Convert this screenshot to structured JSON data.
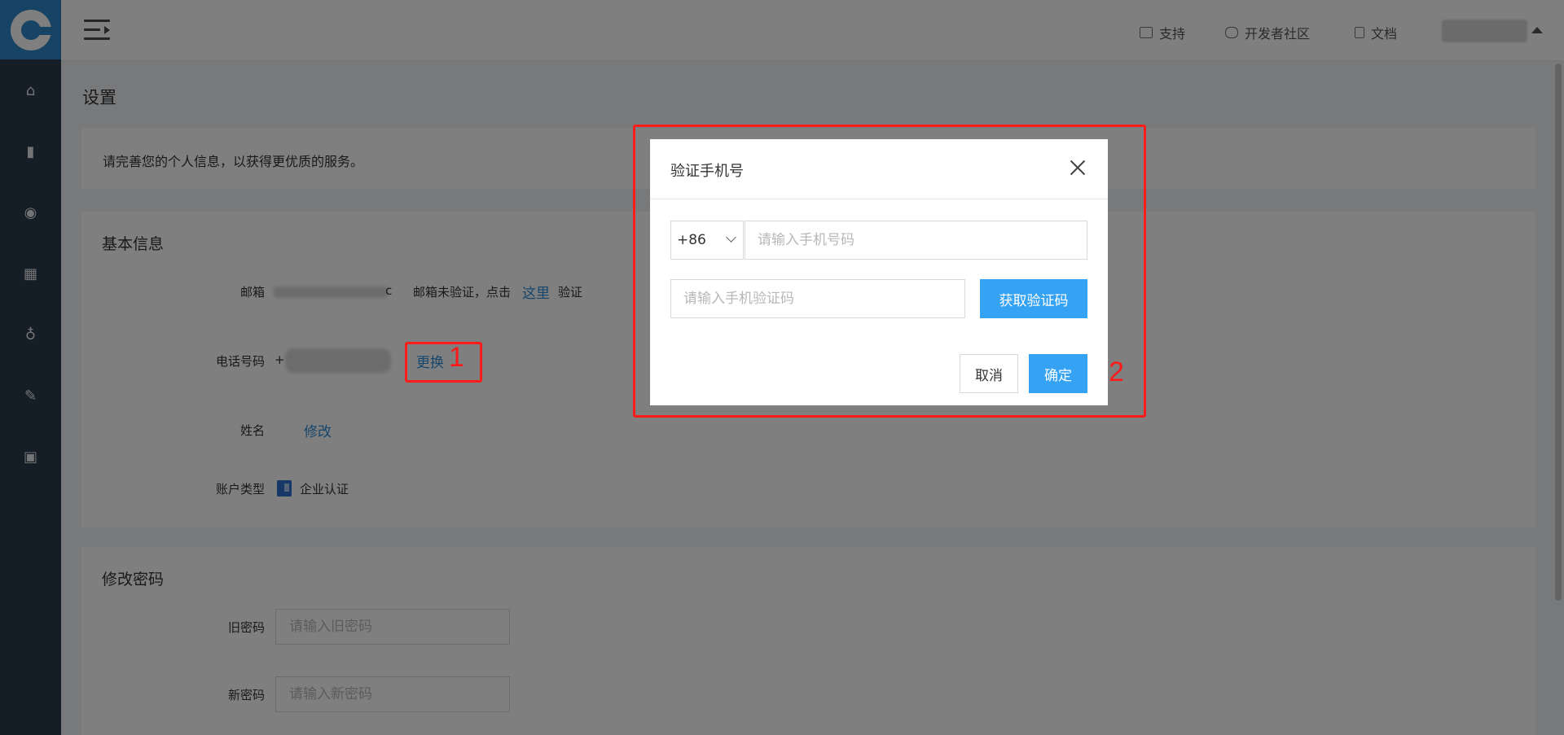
{
  "header": {
    "links": [
      {
        "label": "支持",
        "icon": "printer-icon"
      },
      {
        "label": "开发者社区",
        "icon": "chat-icon"
      },
      {
        "label": "文档",
        "icon": "document-icon"
      }
    ]
  },
  "sidebar": {
    "icons": [
      "home-icon",
      "bar-chart-icon",
      "camera-icon",
      "grid-icon",
      "money-bag-icon",
      "wrench-icon",
      "gift-icon"
    ]
  },
  "page": {
    "title": "设置",
    "notice": "请完善您的个人信息，以获得更优质的服务。"
  },
  "basic_info": {
    "title": "基本信息",
    "email_label": "邮箱",
    "email_suffix": "c",
    "email_unverified_text": "邮箱未验证，点击",
    "email_verify_link": "这里",
    "email_verify_text": "验证",
    "phone_label": "电话号码",
    "phone_prefix": "+",
    "phone_change_link": "更换",
    "name_label": "姓名",
    "name_edit_link": "修改",
    "account_type_label": "账户类型",
    "account_type_value": "企业认证"
  },
  "password": {
    "title": "修改密码",
    "old_label": "旧密码",
    "old_placeholder": "请输入旧密码",
    "new_label": "新密码",
    "new_placeholder": "请输入新密码"
  },
  "modal": {
    "title": "验证手机号",
    "country_code": "+86",
    "phone_placeholder": "请输入手机号码",
    "code_placeholder": "请输入手机验证码",
    "get_code_button": "获取验证码",
    "cancel_button": "取消",
    "confirm_button": "确定"
  },
  "annotations": {
    "label_1": "1",
    "label_2": "2",
    "color": "#ff1a1a"
  }
}
